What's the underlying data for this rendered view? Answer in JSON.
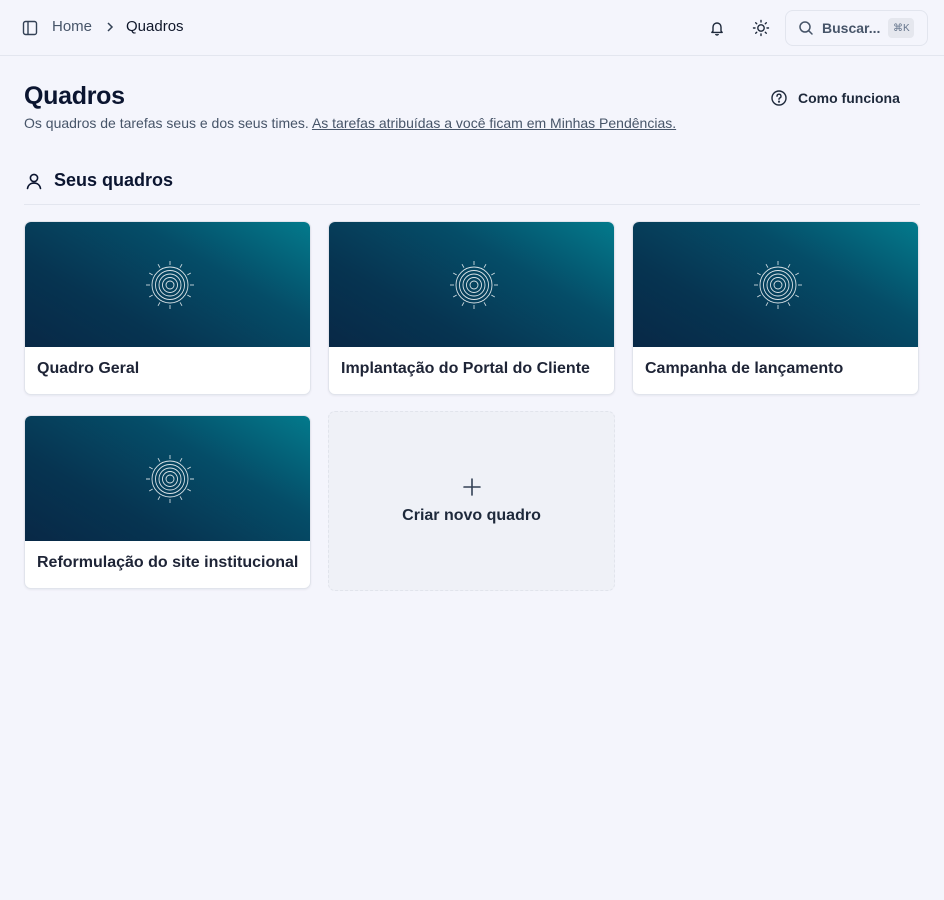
{
  "header": {
    "breadcrumb": {
      "home": "Home",
      "current": "Quadros"
    },
    "search": {
      "label": "Buscar...",
      "shortcut": "⌘K"
    },
    "icons": [
      "sidebar-toggle-icon",
      "chevron-right-icon",
      "bell-icon",
      "sun-icon",
      "search-icon"
    ]
  },
  "page": {
    "title": "Quadros",
    "description": "Os quadros de tarefas seus e dos seus times.",
    "description_link": "As tarefas atribuídas a você ficam em Minhas Pendências.",
    "how_it_works": "Como funciona"
  },
  "section": {
    "title": "Seus quadros",
    "icon": "user-icon"
  },
  "boards": [
    {
      "title": "Quadro Geral"
    },
    {
      "title": "Implantação do Portal do Cliente"
    },
    {
      "title": "Campanha de lançamento"
    },
    {
      "title": "Reformulação do site institucional"
    }
  ],
  "create": {
    "label": "Criar novo quadro",
    "icon": "plus-icon"
  },
  "colors": {
    "background": "#f4f5fc",
    "cover_gradient_start": "#082846",
    "cover_gradient_end": "#037a8c",
    "text_primary": "#0b1530",
    "text_secondary": "#475569"
  }
}
